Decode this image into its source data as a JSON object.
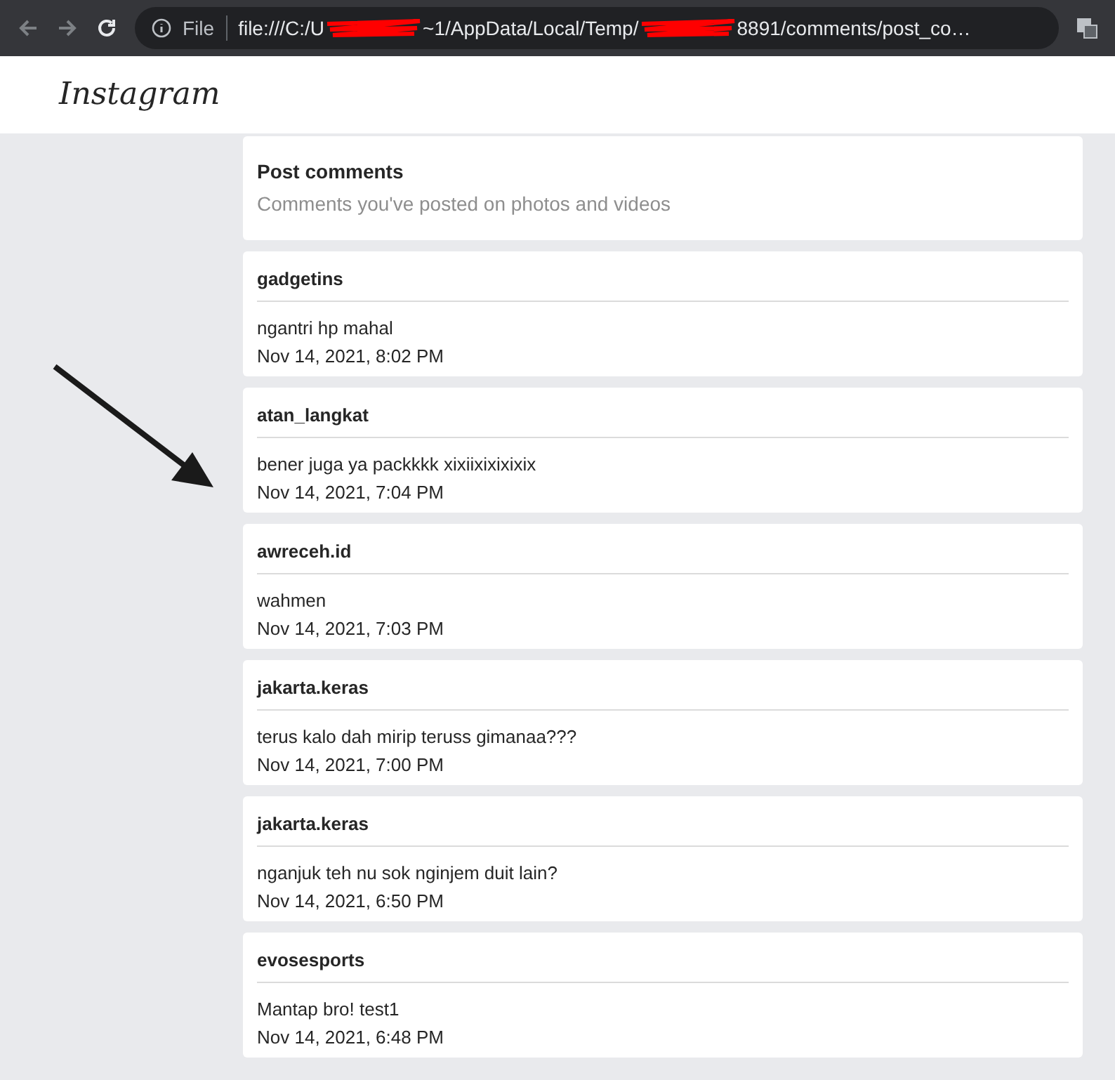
{
  "browser": {
    "scheme_label": "File",
    "url_parts": [
      "file:///C:/U",
      "~1/AppData/Local/Temp/",
      "8891/comments/post_co…"
    ]
  },
  "header": {
    "logo": "Instagram"
  },
  "intro": {
    "title": "Post comments",
    "subtitle": "Comments you've posted on photos and videos"
  },
  "comments": [
    {
      "user": "gadgetins",
      "text": "ngantri hp mahal",
      "time": "Nov 14, 2021, 8:02 PM"
    },
    {
      "user": "atan_langkat",
      "text": "bener juga ya packkkk xixiixixixixix",
      "time": "Nov 14, 2021, 7:04 PM"
    },
    {
      "user": "awreceh.id",
      "text": "wahmen",
      "time": "Nov 14, 2021, 7:03 PM"
    },
    {
      "user": "jakarta.keras",
      "text": "terus kalo dah mirip teruss gimanaa???",
      "time": "Nov 14, 2021, 7:00 PM"
    },
    {
      "user": "jakarta.keras",
      "text": "nganjuk teh nu sok nginjem duit lain?",
      "time": "Nov 14, 2021, 6:50 PM"
    },
    {
      "user": "evosesports",
      "text": "Mantap bro! test1",
      "time": "Nov 14, 2021, 6:48 PM"
    }
  ]
}
